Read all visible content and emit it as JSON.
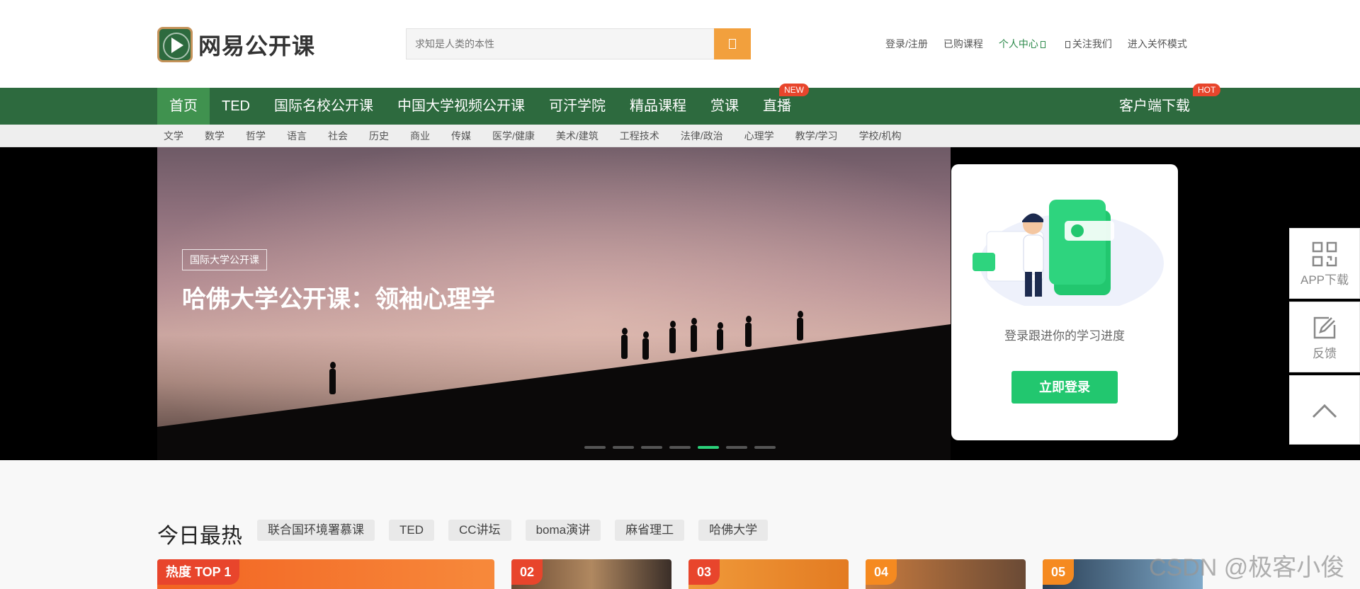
{
  "header": {
    "logo_text": "网易公开课",
    "search_placeholder": "求知是人类的本性",
    "links": {
      "login": "登录/注册",
      "purchased": "已购课程",
      "personal": "个人中心",
      "follow": "关注我们",
      "care_mode": "进入关怀模式"
    }
  },
  "nav": {
    "items": [
      "首页",
      "TED",
      "国际名校公开课",
      "中国大学视频公开课",
      "可汗学院",
      "精品课程",
      "赏课",
      "直播"
    ],
    "new_badge": "NEW",
    "download": "客户端下载",
    "hot_badge": "HOT"
  },
  "subnav": [
    "文学",
    "数学",
    "哲学",
    "语言",
    "社会",
    "历史",
    "商业",
    "传媒",
    "医学/健康",
    "美术/建筑",
    "工程技术",
    "法律/政治",
    "心理学",
    "教学/学习",
    "学校/机构"
  ],
  "banner": {
    "tag": "国际大学公开课",
    "title": "哈佛大学公开课：领袖心理学",
    "slide_count": 7,
    "active_slide": 5
  },
  "login_card": {
    "text": "登录跟进你的学习进度",
    "button": "立即登录"
  },
  "float": {
    "app": "APP下载",
    "feedback": "反馈"
  },
  "hot": {
    "title": "今日最热",
    "tags": [
      "联合国环境署慕课",
      "TED",
      "CC讲坛",
      "boma演讲",
      "麻省理工",
      "哈佛大学"
    ],
    "cards": [
      "热度 TOP 1",
      "02",
      "03",
      "04",
      "05"
    ]
  },
  "watermark": "CSDN @极客小俊",
  "colors": {
    "nav_green": "#2d6a3e",
    "accent_green": "#22c76f",
    "search_orange": "#f2a03d",
    "badge_red": "#e8452c"
  }
}
